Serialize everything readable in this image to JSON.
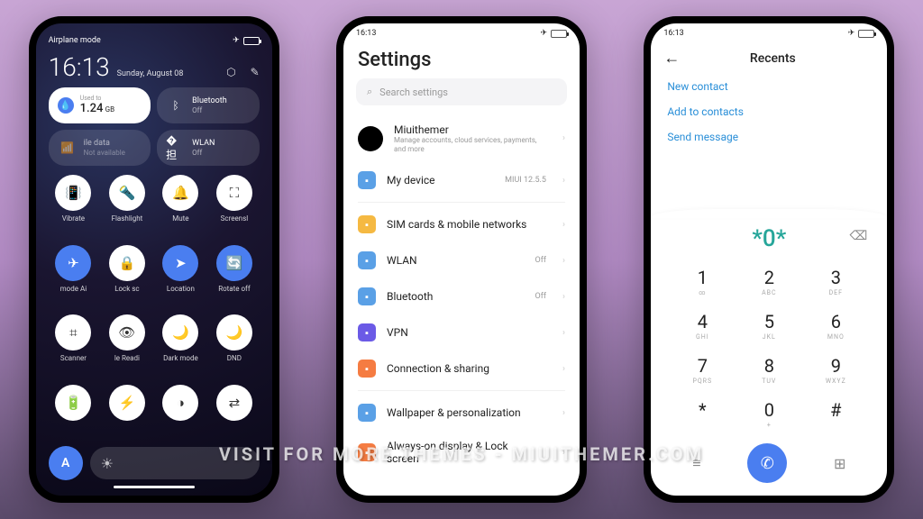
{
  "watermark": "VISIT FOR MORE THEMES - MIUITHEMER.COM",
  "p1": {
    "status_label": "Airplane mode",
    "time": "16:13",
    "date": "Sunday, August 08",
    "tiles": {
      "data": {
        "value": "1.24",
        "unit": "GB",
        "sub": "Used to"
      },
      "bluetooth": {
        "label": "Bluetooth",
        "sub": "Off"
      },
      "mobile": {
        "label": "ile data",
        "sub": "Not available"
      },
      "wlan": {
        "label": "WLAN",
        "sub": "Off"
      }
    },
    "qs": [
      {
        "label": "Vibrate",
        "active": false
      },
      {
        "label": "Flashlight",
        "active": false
      },
      {
        "label": "Mute",
        "active": false
      },
      {
        "label": "Screensl",
        "active": false
      },
      {
        "label": "mode    Ai",
        "active": true
      },
      {
        "label": "Lock sc",
        "active": false
      },
      {
        "label": "Location",
        "active": true
      },
      {
        "label": "Rotate off",
        "active": true
      },
      {
        "label": "Scanner",
        "active": false
      },
      {
        "label": "le   Readi",
        "active": false
      },
      {
        "label": "Dark mode",
        "active": false
      },
      {
        "label": "DND",
        "active": false
      },
      {
        "label": "",
        "active": false
      },
      {
        "label": "",
        "active": false
      },
      {
        "label": "",
        "active": false
      },
      {
        "label": "",
        "active": false
      }
    ],
    "auto": "A"
  },
  "p2": {
    "time": "16:13",
    "title": "Settings",
    "search_placeholder": "Search settings",
    "account": {
      "name": "Miuithemer",
      "sub": "Manage accounts, cloud services, payments, and more"
    },
    "items": [
      {
        "icon_bg": "#5aa0e6",
        "label": "My device",
        "right": "MIUI 12.5.5"
      },
      {
        "icon_bg": "#f5b942",
        "label": "SIM cards & mobile networks",
        "right": ""
      },
      {
        "icon_bg": "#5aa0e6",
        "label": "WLAN",
        "right": "Off"
      },
      {
        "icon_bg": "#5aa0e6",
        "label": "Bluetooth",
        "right": "Off"
      },
      {
        "icon_bg": "#6b5ae6",
        "label": "VPN",
        "right": ""
      },
      {
        "icon_bg": "#f57c42",
        "label": "Connection & sharing",
        "right": ""
      },
      {
        "icon_bg": "#5aa0e6",
        "label": "Wallpaper & personalization",
        "right": ""
      },
      {
        "icon_bg": "#f57c42",
        "label": "Always-on display & Lock screen",
        "right": ""
      }
    ]
  },
  "p3": {
    "time": "16:13",
    "title": "Recents",
    "actions": [
      "New contact",
      "Add to contacts",
      "Send message"
    ],
    "dialed": "*0*",
    "keys": [
      {
        "num": "1",
        "sub": "∞"
      },
      {
        "num": "2",
        "sub": "ABC"
      },
      {
        "num": "3",
        "sub": "DEF"
      },
      {
        "num": "4",
        "sub": "GHI"
      },
      {
        "num": "5",
        "sub": "JKL"
      },
      {
        "num": "6",
        "sub": "MNO"
      },
      {
        "num": "7",
        "sub": "PQRS"
      },
      {
        "num": "8",
        "sub": "TUV"
      },
      {
        "num": "9",
        "sub": "WXYZ"
      },
      {
        "num": "*",
        "sub": ""
      },
      {
        "num": "0",
        "sub": "+"
      },
      {
        "num": "#",
        "sub": ""
      }
    ]
  }
}
